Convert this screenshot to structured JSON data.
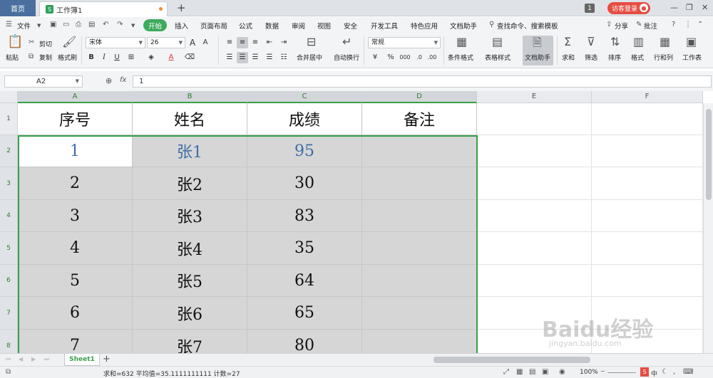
{
  "tabs": {
    "home": "首页",
    "doc_title": "工作簿1",
    "doc_icon": "S",
    "new_tab": "+"
  },
  "titlebar": {
    "badge": "1",
    "login": "访客登录",
    "avatar": "👤"
  },
  "menu": {
    "file": "文件",
    "items": [
      "插入",
      "页面布局",
      "公式",
      "数据",
      "审阅",
      "视图",
      "安全",
      "开发工具",
      "特色应用",
      "文档助手"
    ],
    "active": "开始",
    "search": "查找命令、搜索模板",
    "share": "分享",
    "annotate": "批注"
  },
  "ribbon": {
    "paste": "粘贴",
    "cut": "剪切",
    "copy": "复制",
    "format_painter": "格式刷",
    "font_name": "宋体",
    "font_size": "26",
    "merge_center": "合并居中",
    "wrap_text": "自动换行",
    "number_format": "常规",
    "conditional_format": "条件格式",
    "table_style": "表格样式",
    "doc_assistant": "文档助手",
    "sum": "求和",
    "filter": "筛选",
    "sort": "排序",
    "format": "格式",
    "row_col": "行和列",
    "worksheet": "工作表"
  },
  "formula_bar": {
    "name_box": "A2",
    "fx": "fx",
    "value": "1"
  },
  "grid": {
    "columns": [
      "A",
      "B",
      "C",
      "D",
      "E",
      "F"
    ],
    "rows": [
      "1",
      "2",
      "3",
      "4",
      "5",
      "6",
      "7",
      "8"
    ],
    "header": [
      "序号",
      "姓名",
      "成绩",
      "备注"
    ],
    "data": [
      [
        "1",
        "张1",
        "95",
        ""
      ],
      [
        "2",
        "张2",
        "30",
        ""
      ],
      [
        "3",
        "张3",
        "83",
        ""
      ],
      [
        "4",
        "张4",
        "35",
        ""
      ],
      [
        "5",
        "张5",
        "64",
        ""
      ],
      [
        "6",
        "张6",
        "65",
        ""
      ],
      [
        "7",
        "张7",
        "80",
        ""
      ]
    ]
  },
  "sheets": {
    "active": "Sheet1",
    "add": "+"
  },
  "status": {
    "summary": "求和=632  平均值=35.1111111111  计数=27",
    "zoom": "100%",
    "ime": "中"
  },
  "watermark": {
    "brand": "Baidu经验",
    "url": "jingyan.baidu.com"
  },
  "colors": {
    "accent_green": "#3a9f4a",
    "selection_shade": "#d6d6d6",
    "active_cell_text": "#3f6ea8",
    "login_red": "#e54d42"
  }
}
